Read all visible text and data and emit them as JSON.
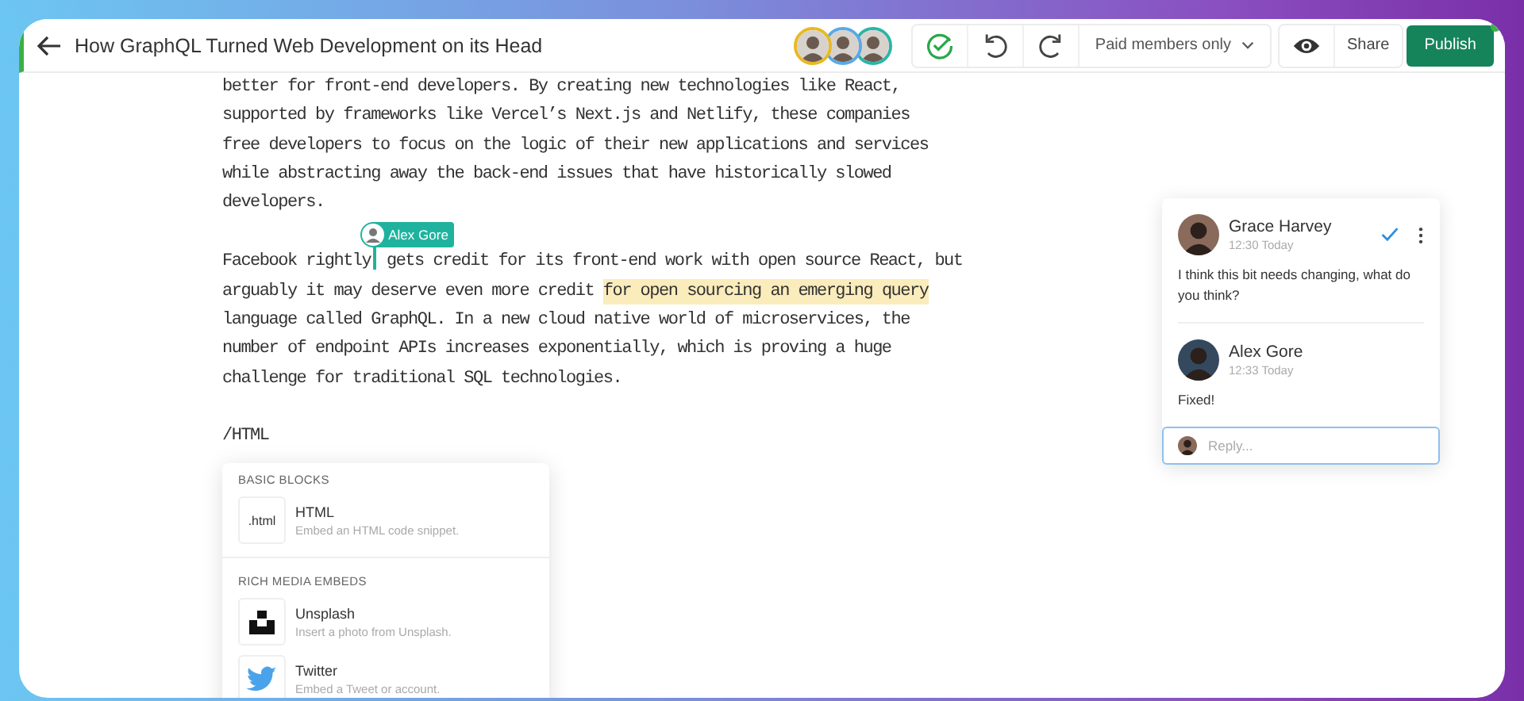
{
  "header": {
    "title": "How GraphQL Turned Web Development on its Head",
    "collaborators": [
      {
        "color": "#e8b923"
      },
      {
        "color": "#5aa9e6"
      },
      {
        "color": "#2bb5a5"
      }
    ],
    "saved": true,
    "visibility": "Paid members only",
    "share": "Share",
    "publish": "Publish",
    "online": true
  },
  "paragraphs": [
    {
      "lines": [
        [
          {
            "kind": "text",
            "text": "better for front-end developers. By creating new technologies like React,"
          }
        ],
        [
          {
            "kind": "text",
            "text": "supported by frameworks like Vercel’s Next.js and Netlify, these companies"
          }
        ],
        [
          {
            "kind": "text",
            "text": "free developers to focus on the logic of their new applications and services"
          }
        ],
        [
          {
            "kind": "text",
            "text": "while abstracting away the back-end issues that have historically slowed"
          }
        ],
        [
          {
            "kind": "text",
            "text": "developers."
          }
        ]
      ]
    },
    {
      "lines": [
        [
          {
            "kind": "text",
            "text": "Facebook rightly"
          },
          {
            "kind": "cursor",
            "name": "Alex Gore"
          },
          {
            "kind": "text",
            "text": " gets credit for its front-end work with open source React, but"
          }
        ],
        [
          {
            "kind": "text",
            "text": "arguably it may deserve even more credit "
          },
          {
            "kind": "highlight",
            "text": "for open sourcing an emerging query"
          }
        ],
        [
          {
            "kind": "text",
            "text": "language called GraphQL. In a new cloud native world of microservices, the"
          }
        ],
        [
          {
            "kind": "text",
            "text": "number of endpoint APIs increases exponentially, which is proving a huge"
          }
        ],
        [
          {
            "kind": "text",
            "text": "challenge for traditional SQL technologies."
          }
        ]
      ]
    },
    {
      "lines": [
        [
          {
            "kind": "text",
            "text": "/HTML"
          }
        ]
      ]
    }
  ],
  "comments": {
    "resolved": true,
    "items": [
      {
        "author": "Grace Harvey",
        "time": "12:30 Today",
        "text": "I think this bit needs changing, what do you think?"
      },
      {
        "author": "Alex Gore",
        "time": "12:33 Today",
        "text": "Fixed!"
      }
    ],
    "reply_placeholder": "Reply..."
  },
  "block_menu": {
    "sections": [
      {
        "heading": "BASIC BLOCKS",
        "items": [
          {
            "kind": "html",
            "icon_label": ".html",
            "title": "HTML",
            "description": "Embed an HTML code snippet."
          }
        ]
      },
      {
        "heading": "RICH MEDIA EMBEDS",
        "items": [
          {
            "kind": "unsplash",
            "title": "Unsplash",
            "description": "Insert a photo from Unsplash."
          },
          {
            "kind": "twitter",
            "title": "Twitter",
            "description": "Embed a Tweet or account."
          }
        ]
      }
    ]
  }
}
